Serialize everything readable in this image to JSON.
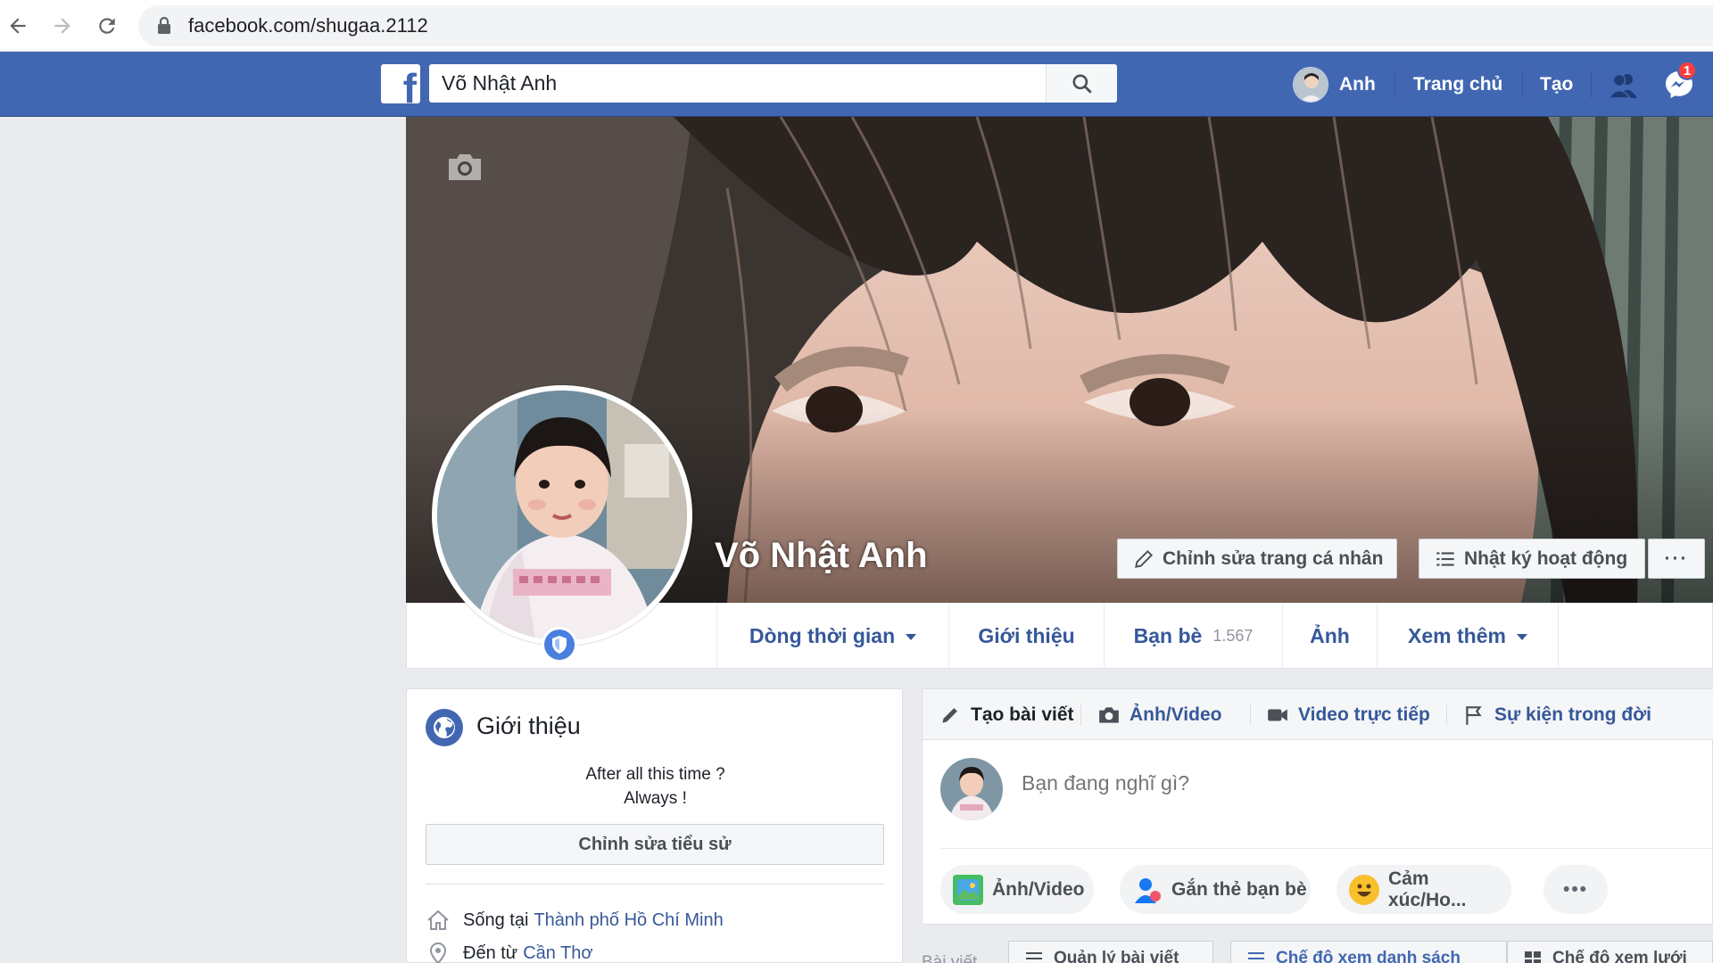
{
  "browser": {
    "url": "facebook.com/shugaa.2112"
  },
  "topbar": {
    "logo": "f",
    "search_value": "Võ Nhật Anh",
    "user_label": "Anh",
    "home_label": "Trang chủ",
    "create_label": "Tạo",
    "messenger_badge": "1",
    "brand_color": "#4267b2"
  },
  "profile": {
    "name": "Võ Nhật Anh",
    "edit_profile_label": "Chỉnh sửa trang cá nhân",
    "activity_log_label": "Nhật ký hoạt động",
    "more_label": "···"
  },
  "tabs": {
    "timeline": "Dòng thời gian",
    "about": "Giới thiệu",
    "friends": "Bạn bè",
    "friends_count": "1.567",
    "photos": "Ảnh",
    "more": "Xem thêm"
  },
  "intro": {
    "title": "Giới thiệu",
    "bio_line1": "After all this time ?",
    "bio_line2": "Always !",
    "edit_bio_label": "Chỉnh sửa tiểu sử",
    "lives_prefix": "Sống tại",
    "lives_city": "Thành phố Hồ Chí Minh",
    "from_prefix": "Đến từ",
    "from_city": "Cần Thơ"
  },
  "composer": {
    "tab_create_post": "Tạo bài viết",
    "tab_photo_video": "Ảnh/Video",
    "tab_live_video": "Video trực tiếp",
    "tab_life_event": "Sự kiện trong đời",
    "placeholder": "Bạn đang nghĩ gì?",
    "pill_photo": "Ảnh/Video",
    "pill_tag": "Gắn thẻ bạn bè",
    "pill_feeling": "Cảm xúc/Ho...",
    "pill_more": "•••"
  },
  "posts_bar": {
    "label": "Bài viết",
    "manage_label": "Quản lý bài viết",
    "list_view_label": "Chế độ xem danh sách",
    "grid_view_label": "Chế độ xem lưới"
  }
}
